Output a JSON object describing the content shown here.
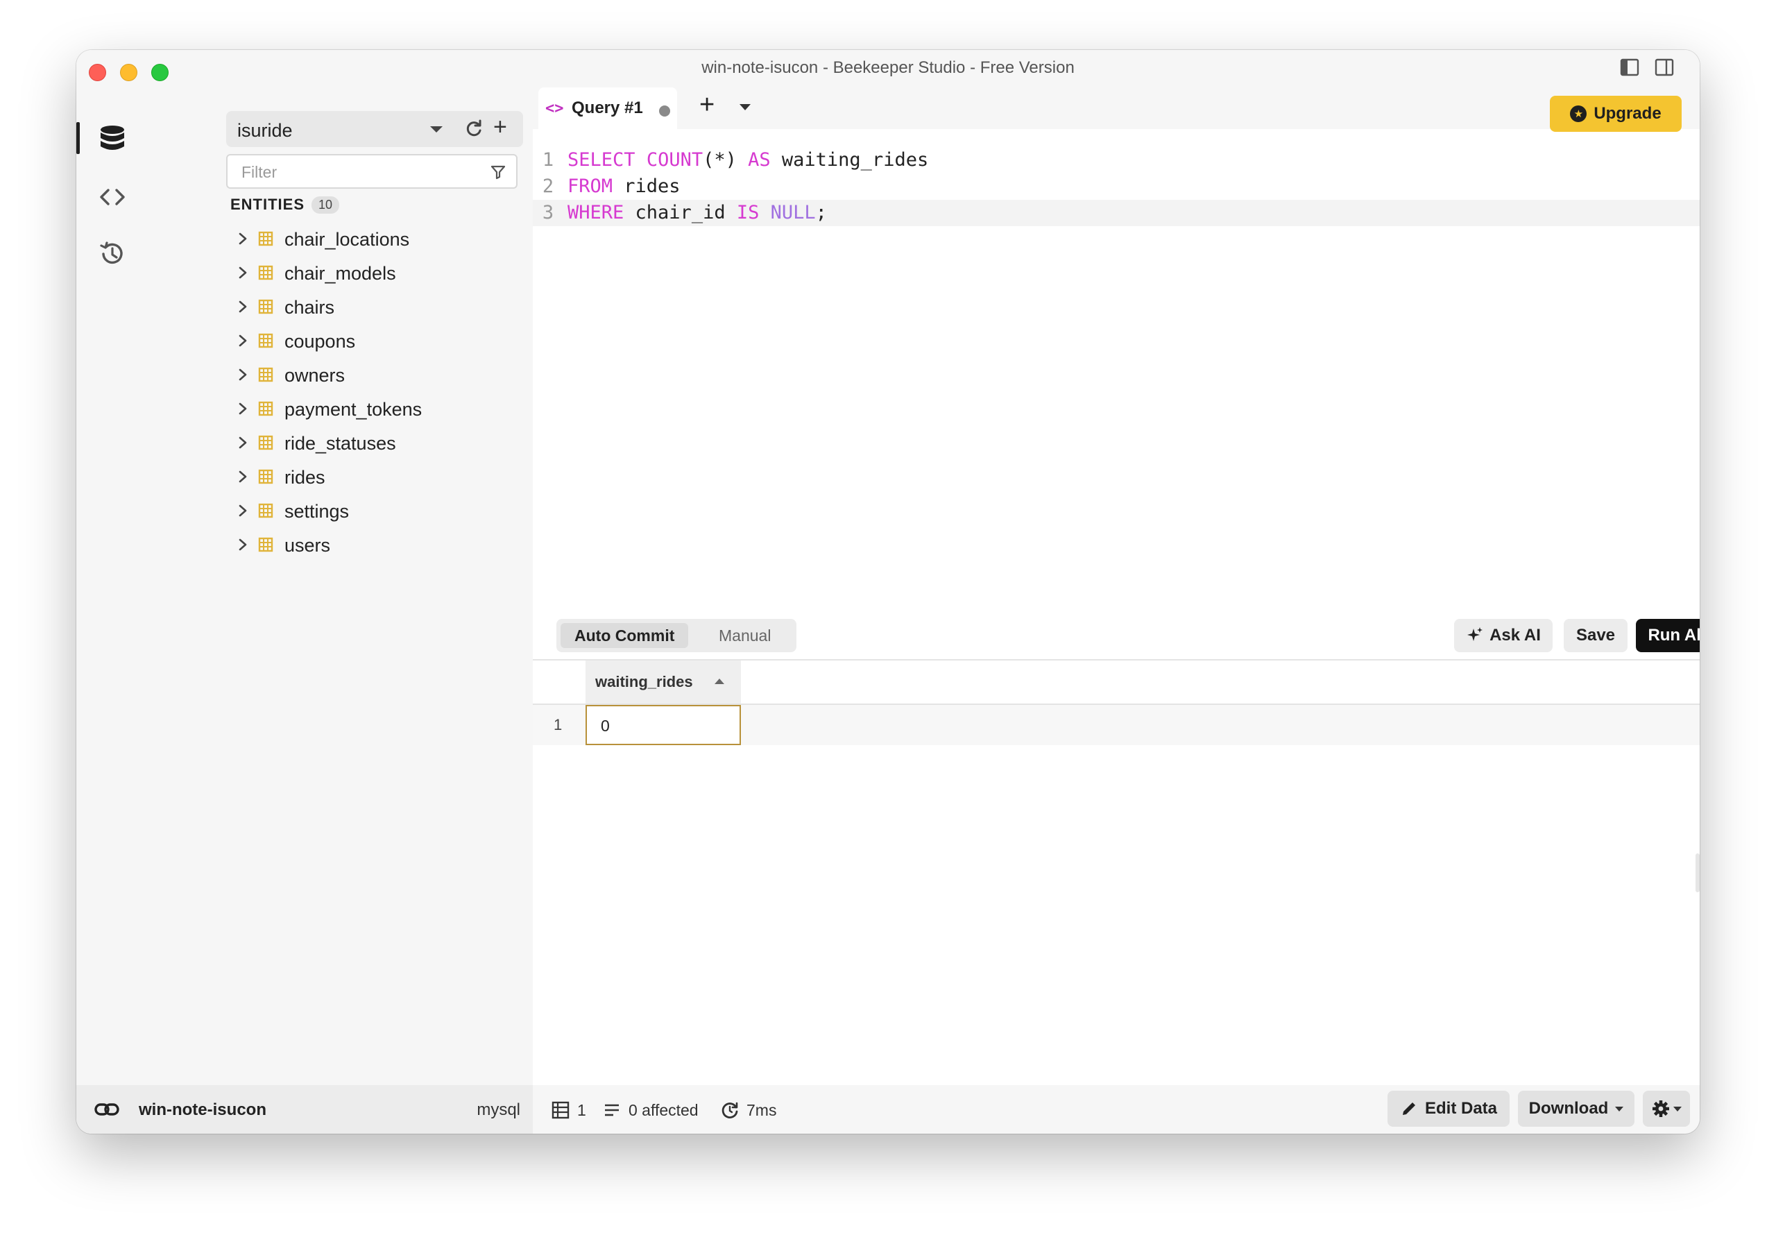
{
  "window": {
    "title": "win-note-isucon - Beekeeper Studio - Free Version"
  },
  "sidebar": {
    "connection_name": "isuride",
    "filter_placeholder": "Filter",
    "entities_label": "ENTITIES",
    "entities_count": "10",
    "entities": [
      {
        "name": "chair_locations"
      },
      {
        "name": "chair_models"
      },
      {
        "name": "chairs"
      },
      {
        "name": "coupons"
      },
      {
        "name": "owners"
      },
      {
        "name": "payment_tokens"
      },
      {
        "name": "ride_statuses"
      },
      {
        "name": "rides"
      },
      {
        "name": "settings"
      },
      {
        "name": "users"
      }
    ]
  },
  "tabs": {
    "active_tab_label": "Query #1",
    "upgrade_label": "Upgrade"
  },
  "editor": {
    "lines": [
      {
        "num": "1",
        "parts": [
          {
            "t": "SELECT",
            "c": "kw"
          },
          {
            "t": " ",
            "c": ""
          },
          {
            "t": "COUNT",
            "c": "fn"
          },
          {
            "t": "(*) ",
            "c": ""
          },
          {
            "t": "AS",
            "c": "kw"
          },
          {
            "t": " waiting_rides",
            "c": ""
          }
        ]
      },
      {
        "num": "2",
        "parts": [
          {
            "t": "FROM",
            "c": "kw"
          },
          {
            "t": " rides",
            "c": ""
          }
        ]
      },
      {
        "num": "3",
        "parts": [
          {
            "t": "WHERE",
            "c": "kw"
          },
          {
            "t": " chair_id ",
            "c": ""
          },
          {
            "t": "IS",
            "c": "kw"
          },
          {
            "t": " ",
            "c": ""
          },
          {
            "t": "NULL",
            "c": "nl"
          },
          {
            "t": ";",
            "c": ""
          }
        ]
      }
    ]
  },
  "toolbar": {
    "auto_commit_label": "Auto Commit",
    "manual_label": "Manual",
    "ask_ai_label": "Ask AI",
    "save_label": "Save",
    "run_all_label": "Run All"
  },
  "results": {
    "columns": [
      "waiting_rides"
    ],
    "rows": [
      {
        "row_number": "1",
        "cells": [
          "0"
        ]
      }
    ]
  },
  "statusbar": {
    "connection_name": "win-note-isucon",
    "db_type": "mysql",
    "row_count": "1",
    "affected": "0 affected",
    "duration": "7ms",
    "edit_data_label": "Edit Data",
    "download_label": "Download"
  },
  "colors": {
    "accent_upgrade": "#f4c430",
    "keyword": "#d63ad0",
    "null_literal": "#a070e0",
    "table_icon": "#e0b43a",
    "cell_focus": "#b8913a"
  }
}
